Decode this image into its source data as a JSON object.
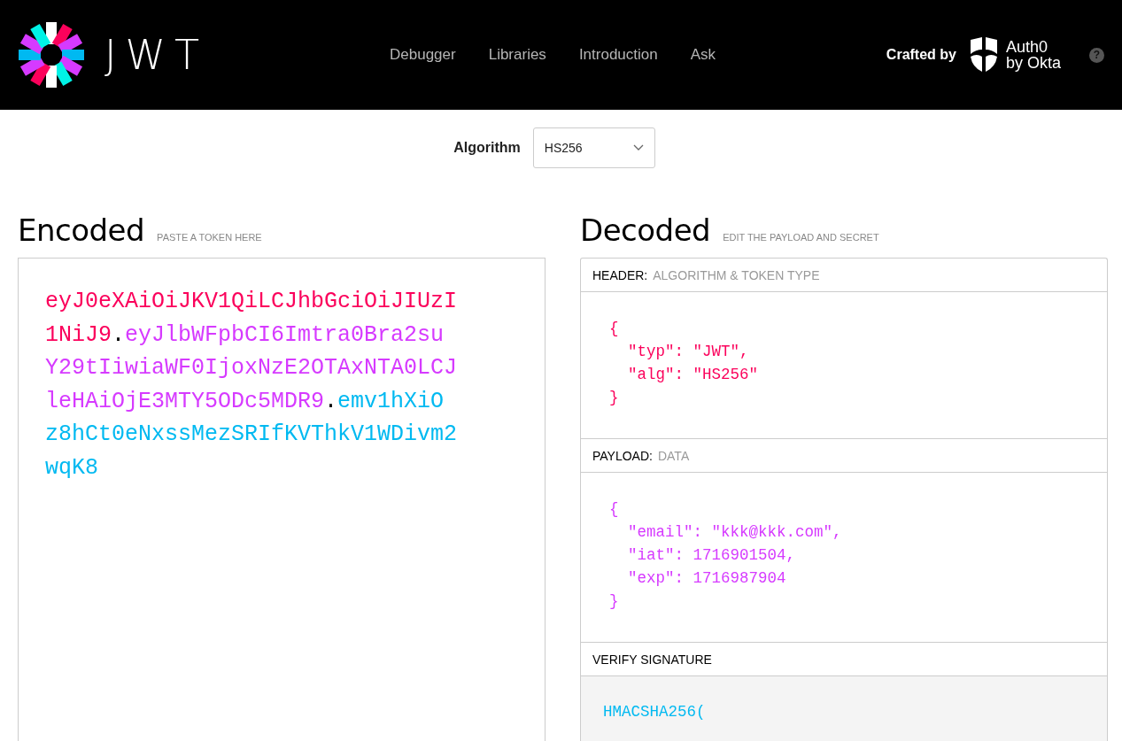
{
  "header": {
    "logo_text": "JWT",
    "nav": [
      {
        "label": "Debugger",
        "selected": false
      },
      {
        "label": "Libraries",
        "selected": false
      },
      {
        "label": "Introduction",
        "selected": false
      },
      {
        "label": "Ask",
        "selected": false
      }
    ],
    "crafted_by": "Crafted by",
    "brand_lines": [
      "Auth0",
      "by Okta"
    ],
    "help": "?"
  },
  "algorithm": {
    "label": "Algorithm",
    "value": "HS256"
  },
  "encoded": {
    "title": "Encoded",
    "hint": "PASTE A TOKEN HERE",
    "token_parts": [
      {
        "text": "eyJ0eXAiOiJKV1QiLCJhbGciOiJIUzI1NiJ9",
        "color": "#fb015b"
      },
      {
        "text": ".",
        "color": "#000000"
      },
      {
        "text": "eyJlbWFpbCI6Imtra0Bra2suY29tIiwiaWF0IjoxNzE2OTAxNTA0LCJleHAiOjE3MTY5ODc5MDR9",
        "color": "#d63aff"
      },
      {
        "text": ".",
        "color": "#000000"
      },
      {
        "text": "emv1hXiOz8hCt0eNxssMezSRIfKVThkV1WDivm2wqK8",
        "color": "#00b9f1"
      }
    ]
  },
  "decoded": {
    "title": "Decoded",
    "hint": "EDIT THE PAYLOAD AND SECRET",
    "sections": [
      {
        "kind": "code",
        "title": "HEADER:",
        "subtitle": "ALGORITHM & TOKEN TYPE",
        "color": "#fb015b",
        "lines": [
          "{",
          "  \"typ\": \"JWT\",",
          "  \"alg\": \"HS256\"",
          "}"
        ]
      },
      {
        "kind": "code",
        "title": "PAYLOAD:",
        "subtitle": "DATA",
        "color": "#d63aff",
        "lines": [
          "{",
          "  \"email\": \"kkk@kkk.com\",",
          "  \"iat\": 1716901504,",
          "  \"exp\": 1716987904",
          "}"
        ]
      },
      {
        "kind": "signature",
        "title": "VERIFY SIGNATURE",
        "color": "#00b9f1",
        "lines": [
          "HMACSHA256("
        ]
      }
    ]
  }
}
